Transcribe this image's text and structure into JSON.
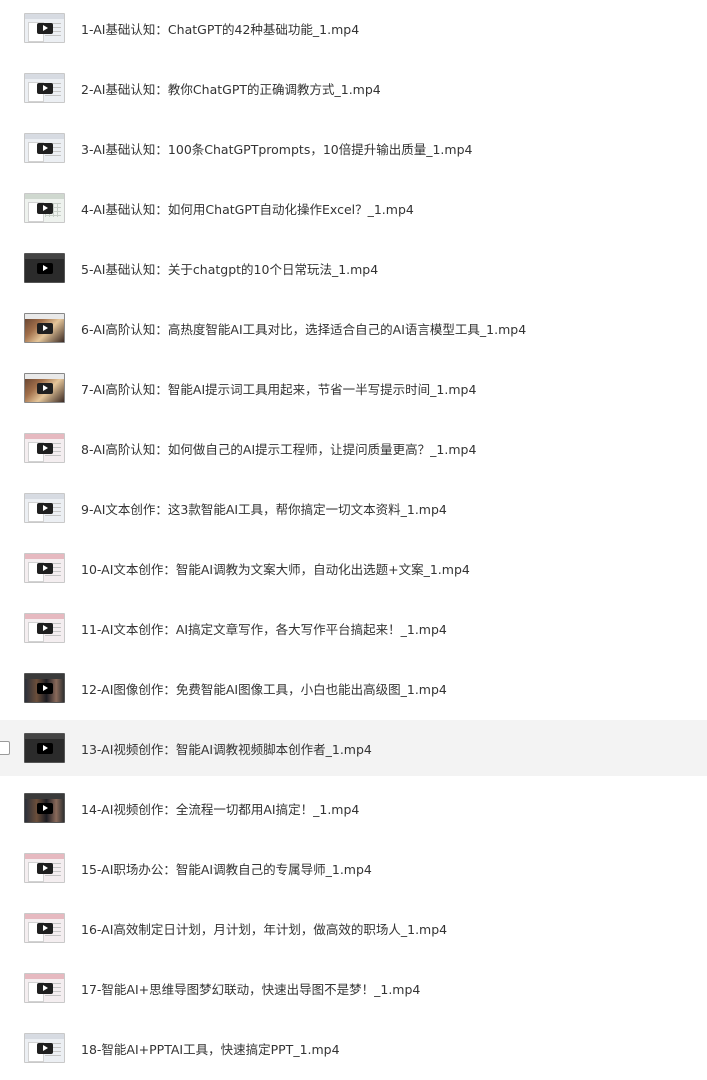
{
  "files": [
    {
      "name": "1-AI基础认知：ChatGPT的42种基础功能_1.mp4",
      "thumb_icon": "video-thumbnail"
    },
    {
      "name": "2-AI基础认知：教你ChatGPT的正确调教方式_1.mp4",
      "thumb_icon": "video-thumbnail"
    },
    {
      "name": "3-AI基础认知：100条ChatGPTprompts，10倍提升输出质量_1.mp4",
      "thumb_icon": "video-thumbnail"
    },
    {
      "name": "4-AI基础认知：如何用ChatGPT自动化操作Excel？_1.mp4",
      "thumb_icon": "video-thumbnail"
    },
    {
      "name": "5-AI基础认知：关于chatgpt的10个日常玩法_1.mp4",
      "thumb_icon": "video-thumbnail"
    },
    {
      "name": "6-AI高阶认知：高热度智能AI工具对比，选择适合自己的AI语言模型工具_1.mp4",
      "thumb_icon": "video-thumbnail"
    },
    {
      "name": "7-AI高阶认知：智能AI提示词工具用起来，节省一半写提示时间_1.mp4",
      "thumb_icon": "video-thumbnail"
    },
    {
      "name": "8-AI高阶认知：如何做自己的AI提示工程师，让提问质量更高？_1.mp4",
      "thumb_icon": "video-thumbnail"
    },
    {
      "name": "9-AI文本创作：这3款智能AI工具，帮你搞定一切文本资料_1.mp4",
      "thumb_icon": "video-thumbnail"
    },
    {
      "name": "10-AI文本创作：智能AI调教为文案大师，自动化出选题+文案_1.mp4",
      "thumb_icon": "video-thumbnail"
    },
    {
      "name": "11-AI文本创作：AI搞定文章写作，各大写作平台搞起来！_1.mp4",
      "thumb_icon": "video-thumbnail"
    },
    {
      "name": "12-AI图像创作：免费智能AI图像工具，小白也能出高级图_1.mp4",
      "thumb_icon": "video-thumbnail"
    },
    {
      "name": "13-AI视频创作：智能AI调教视频脚本创作者_1.mp4",
      "thumb_icon": "video-thumbnail"
    },
    {
      "name": "14-AI视频创作：全流程一切都用AI搞定！_1.mp4",
      "thumb_icon": "video-thumbnail"
    },
    {
      "name": "15-AI职场办公：智能AI调教自己的专属导师_1.mp4",
      "thumb_icon": "video-thumbnail"
    },
    {
      "name": "16-AI高效制定日计划，月计划，年计划，做高效的职场人_1.mp4",
      "thumb_icon": "video-thumbnail"
    },
    {
      "name": "17-智能AI+思维导图梦幻联动，快速出导图不是梦！_1.mp4",
      "thumb_icon": "video-thumbnail"
    },
    {
      "name": "18-智能AI+PPTAI工具，快速搞定PPT_1.mp4",
      "thumb_icon": "video-thumbnail"
    }
  ],
  "colors": {
    "text": "#333333",
    "hover_row": "#f3f3f3",
    "background": "#ffffff"
  }
}
